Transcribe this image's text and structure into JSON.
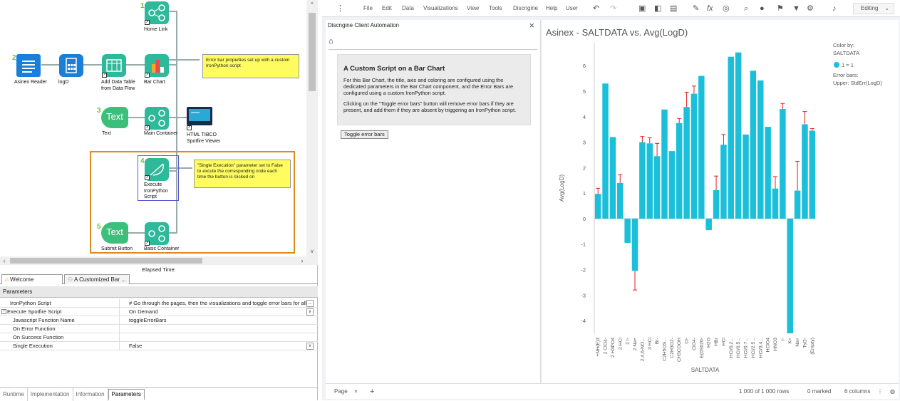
{
  "workflow": {
    "nodes": [
      {
        "num": "1",
        "label": "Home Link"
      },
      {
        "num": "2",
        "label": "Asinex Reader"
      },
      {
        "num": "",
        "label": "logD"
      },
      {
        "num": "",
        "label": "Add Data Table\nfrom Data Flow"
      },
      {
        "num": "",
        "label": "Bar Chart"
      },
      {
        "num": "3",
        "label": "Text"
      },
      {
        "num": "",
        "label": "Main Container"
      },
      {
        "num": "",
        "label": "HTML TIBCO\nSpotfire Viewer"
      },
      {
        "num": "4",
        "label": "Execute\nIronPython\nScript"
      },
      {
        "num": "5",
        "label": "Submit Button"
      },
      {
        "num": "",
        "label": "Basic Container"
      }
    ],
    "text_node_label": "Text",
    "note1": "Error bar properties set up with a custom IronPython script",
    "note2": "\"Single Execution\" parameter set to False to excute the corresponding code each time the button is clicked on"
  },
  "elapsed": "Elapsed Time:",
  "tabs": [
    "Welcome",
    "A Customized Bar ..."
  ],
  "params": {
    "header": "Parameters",
    "rows": [
      {
        "k": "IronPython Script",
        "v": "# Go through the pages, then the visualizations and toggle error bars for all ..."
      },
      {
        "k": "Execute Spotfire Script",
        "v": "On Demand"
      },
      {
        "k": "Javascript Function Name",
        "v": "toggleErrorBars"
      },
      {
        "k": "On Error Function",
        "v": ""
      },
      {
        "k": "On Success Function",
        "v": ""
      },
      {
        "k": "Single Execution",
        "v": "False"
      }
    ]
  },
  "bottom_tabs": [
    "Runtime",
    "Implementation",
    "Information",
    "Parameters"
  ],
  "menu": [
    "File",
    "Edit",
    "Data",
    "Visualizations",
    "View",
    "Tools",
    "Discngine",
    "Help",
    "User"
  ],
  "editing": "Editing",
  "textpanel": {
    "title": "Discngine Client Automation",
    "heading": "A Custom Script on a Bar Chart",
    "p1": "For this Bar Chart, the title, axis and coloring are configured using the dedicated parameters in the Bar Chart component, and the Error Bars are configured using a custom IronPython script.",
    "p2": "Clicking on the \"Toggle error bars\" button will remove error bars if they are present, and add them if they are absent by triggering an IronPython script.",
    "button": "Toggle error bars"
  },
  "legend": {
    "title": "Color by:",
    "field": "SALTDATA",
    "item": "1 = 1",
    "eb_title": "Error bars:",
    "eb_value": "Upper: StdErr(LogD)"
  },
  "chart_data": {
    "type": "bar",
    "title": "Asinex - SALTDATA vs. Avg(LogD)",
    "xlabel": "SALTDATA",
    "ylabel": "Avg(LogD)",
    "ylim": [
      -4.5,
      6.9
    ],
    "yticks": [
      -4,
      -3,
      -2,
      -1,
      0,
      1,
      2,
      3,
      4,
      5,
      6
    ],
    "color": "#1bbfd9",
    "errcolor": "#e02020",
    "categories": [
      "+NH(E)3",
      "2 ClO4-",
      "2 H3PO4",
      "2 HCl",
      "2 I-",
      "2 Na+",
      "2,4,6-NO...",
      "3 HCl",
      "Br-",
      "C2H5OS...",
      "C2H3O2-",
      "CH3COOH",
      "Cl-",
      "ClO4-",
      "E(0S020-",
      "H2O",
      "HBr",
      "HCl",
      "HCl/0.2...",
      "HCl/0.5...",
      "HCl/0.7...",
      "HCl/2.5...",
      "HCl/3.4...",
      "HClO4",
      "HNO3",
      "I-",
      "K+",
      "Na+",
      "TsO-",
      "(Empty)"
    ],
    "values": [
      0.97,
      5.3,
      3.2,
      1.4,
      -0.95,
      -2.05,
      3.0,
      2.95,
      2.45,
      4.28,
      2.65,
      3.75,
      4.38,
      4.9,
      5.6,
      -0.45,
      1.12,
      2.9,
      6.35,
      6.52,
      3.3,
      5.8,
      5.42,
      3.6,
      1.18,
      4.3,
      -4.5,
      1.1,
      3.7,
      3.45
    ],
    "errors": [
      0.22,
      0,
      0,
      0.32,
      0,
      0.75,
      0.22,
      0.22,
      0.5,
      0,
      0,
      0.18,
      0.58,
      0.3,
      0,
      0,
      0.55,
      0.4,
      0,
      0,
      0,
      0,
      0,
      0,
      0.47,
      0.22,
      0,
      1.15,
      0.5,
      0.08
    ]
  },
  "pagebar": {
    "page": "Page",
    "rows": "1 000 of 1 000 rows",
    "marked": "0 marked",
    "cols": "6 columns"
  }
}
